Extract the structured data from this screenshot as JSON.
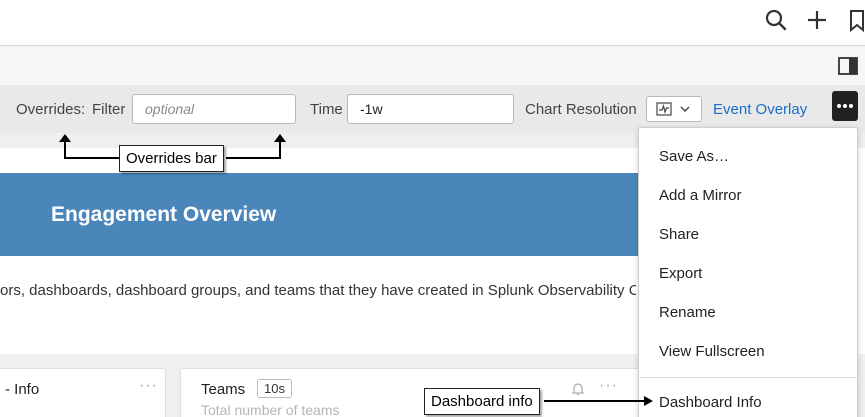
{
  "topbar": {
    "icons": [
      "search-icon",
      "plus-icon",
      "bookmark-icon"
    ]
  },
  "subbar": {
    "icons": [
      "panel-toggle-icon"
    ]
  },
  "overrides": {
    "label": "Overrides:",
    "filter_label": "Filter",
    "filter_placeholder": "optional",
    "time_label": "Time",
    "time_value": "-1w",
    "resolution_label": "Chart Resolution",
    "event_overlay_link": "Event Overlay"
  },
  "dashboard": {
    "title": "Engagement Overview",
    "description": "ors, dashboards, dashboard groups, and teams that they have created in Splunk Observability Cl",
    "cards": [
      {
        "title": "- Info"
      },
      {
        "title": "Teams",
        "badge": "10s",
        "subtitle": "Total number of teams"
      }
    ]
  },
  "menu": {
    "items": [
      {
        "label": "Save As…"
      },
      {
        "label": "Add a Mirror"
      },
      {
        "label": "Share"
      },
      {
        "label": "Export"
      },
      {
        "label": "Rename"
      },
      {
        "label": "View Fullscreen"
      },
      {
        "label": "Dashboard Info"
      }
    ]
  },
  "annotations": {
    "overrides_bar": "Overrides bar",
    "dashboard_info": "Dashboard info"
  },
  "colors": {
    "banner": "#4a86ba",
    "link": "#1a6cc7",
    "more_button": "#222222"
  }
}
